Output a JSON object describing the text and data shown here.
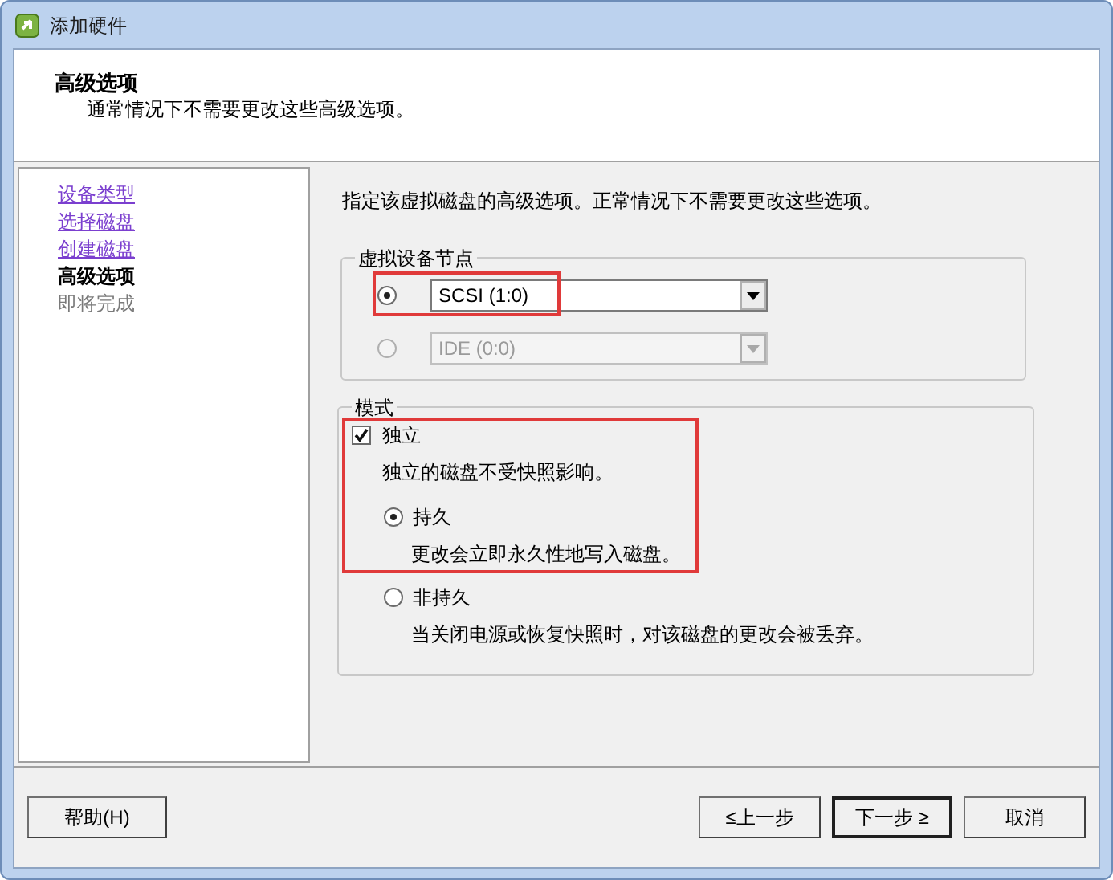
{
  "window": {
    "title": "添加硬件"
  },
  "header": {
    "title": "高级选项",
    "subtitle": "通常情况下不需要更改这些高级选项。"
  },
  "steps": [
    {
      "label": "设备类型",
      "visited": true,
      "selected": false,
      "disabled": false
    },
    {
      "label": "选择磁盘",
      "visited": true,
      "selected": false,
      "disabled": false
    },
    {
      "label": "创建磁盘",
      "visited": true,
      "selected": false,
      "disabled": false
    },
    {
      "label": "高级选项",
      "visited": false,
      "selected": true,
      "disabled": false
    },
    {
      "label": "即将完成",
      "visited": false,
      "selected": false,
      "disabled": true
    }
  ],
  "description": "指定该虚拟磁盘的高级选项。正常情况下不需要更改这些选项。",
  "device_node": {
    "legend": "虚拟设备节点",
    "options": [
      {
        "value": "SCSI (1:0)",
        "selected": true,
        "disabled": false
      },
      {
        "value": "IDE (0:0)",
        "selected": false,
        "disabled": true
      }
    ]
  },
  "mode": {
    "legend": "模式",
    "independent": {
      "label": "独立",
      "checked": true,
      "description": "独立的磁盘不受快照影响。"
    },
    "options": [
      {
        "label": "持久",
        "description": "更改会立即永久性地写入磁盘。",
        "selected": true
      },
      {
        "label": "非持久",
        "description": "当关闭电源或恢复快照时，对该磁盘的更改会被丢弃。",
        "selected": false
      }
    ]
  },
  "buttons": [
    {
      "label": "帮助(H)",
      "kind": "help"
    },
    {
      "label": "≤上一步",
      "kind": "nav"
    },
    {
      "label": "下一步 ≥",
      "kind": "default"
    },
    {
      "label": "取消",
      "kind": "nav"
    }
  ]
}
